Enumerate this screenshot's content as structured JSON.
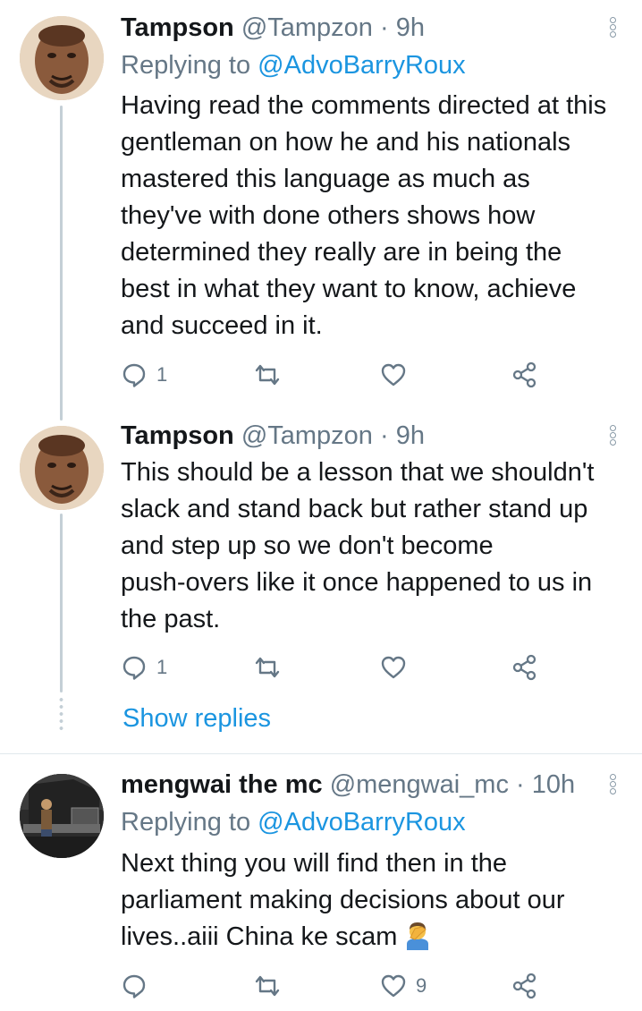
{
  "tweets": [
    {
      "name": "Tampson",
      "handle": "@Tampzon",
      "sep": "·",
      "time": "9h",
      "replying_label": "Replying to",
      "replying_to": "@AdvoBarryRoux",
      "lines": [
        "Having read the comments directed at this",
        "gentleman on how he and his nationals",
        "mastered this language as much as",
        "they've with done others shows how",
        "determined they really are in being the",
        "best in what they want to know, achieve",
        "and succeed in it."
      ],
      "reply_count": "1",
      "retweet_count": "",
      "like_count": ""
    },
    {
      "name": "Tampson",
      "handle": "@Tampzon",
      "sep": "·",
      "time": "9h",
      "lines": [
        "This should be a lesson that we shouldn't",
        "slack and stand back but rather stand up",
        "and step up so we don't become",
        "push-overs like it once happened to us in",
        "the past."
      ],
      "reply_count": "1",
      "retweet_count": "",
      "like_count": ""
    },
    {
      "name": "mengwai the mc",
      "handle": "@mengwai_mc",
      "sep": "·",
      "time": "10h",
      "replying_label": "Replying to",
      "replying_to": "@AdvoBarryRoux",
      "lines": [
        "Next thing you will find then in the",
        "parliament making decisions about our",
        "lives..aiii China ke scam"
      ],
      "emoji": "man-facepalming-emoji",
      "reply_count": "",
      "retweet_count": "",
      "like_count": "9"
    }
  ],
  "show_replies": "Show replies",
  "colors": {
    "text": "#14171a",
    "secondary": "#657786",
    "link": "#1b95e0",
    "thread_line": "#c4cfd6",
    "divider": "#e1e8ed"
  },
  "icons": [
    "reply-icon",
    "retweet-icon",
    "like-icon",
    "share-icon",
    "more-options-icon"
  ]
}
